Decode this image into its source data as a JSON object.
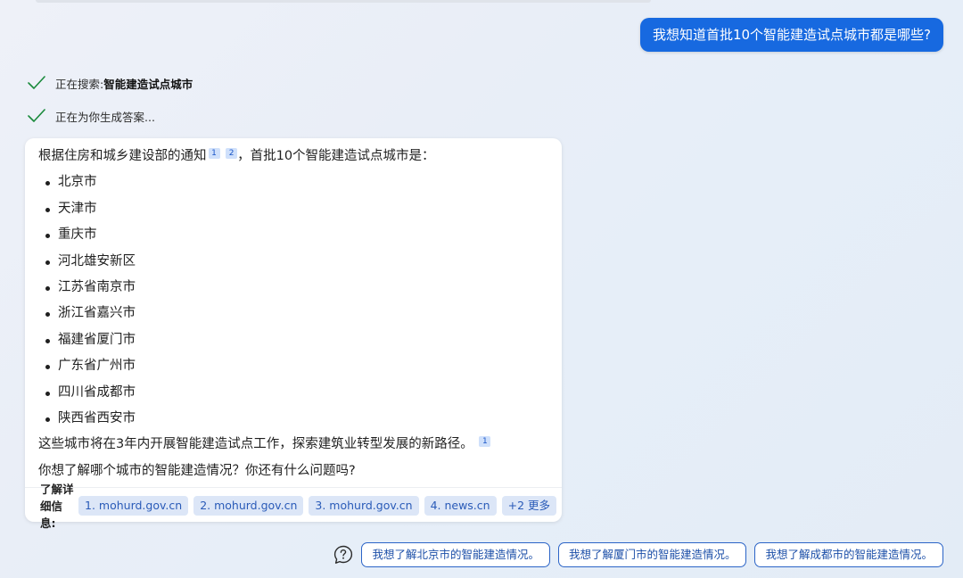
{
  "user_message": "我想知道首批10个智能建造试点城市都是哪些?",
  "status": {
    "searching_prefix": "正在搜索: ",
    "searching_query": "智能建造试点城市",
    "generating": "正在为你生成答案..."
  },
  "answer": {
    "intro_before": "根据住房和城乡建设部的通知",
    "intro_cites": [
      "1",
      "2"
    ],
    "intro_after": "，首批10个智能建造试点城市是：",
    "cities": [
      "北京市",
      "天津市",
      "重庆市",
      "河北雄安新区",
      "江苏省南京市",
      "浙江省嘉兴市",
      "福建省厦门市",
      "广东省广州市",
      "四川省成都市",
      "陕西省西安市"
    ],
    "summary": "这些城市将在3年内开展智能建造试点工作，探索建筑业转型发展的新路径。",
    "summary_cite": "1",
    "question": "你想了解哪个城市的智能建造情况？你还有什么问题吗?"
  },
  "sources": {
    "label": "了解详细信息:",
    "items": [
      "1. mohurd.gov.cn",
      "2. mohurd.gov.cn",
      "3. mohurd.gov.cn",
      "4. news.cn"
    ],
    "more": "+2 更多"
  },
  "suggestions": [
    "我想了解北京市的智能建造情况。",
    "我想了解厦门市的智能建造情况。",
    "我想了解成都市的智能建造情况。"
  ],
  "icons": {
    "status_check": "check-icon",
    "suggestion_help": "question-icon"
  },
  "colors": {
    "user_bubble": "#1769e0",
    "check": "#1a8a3c",
    "chip_bg": "#dce6f7",
    "accent_text": "#2a5bb8"
  }
}
